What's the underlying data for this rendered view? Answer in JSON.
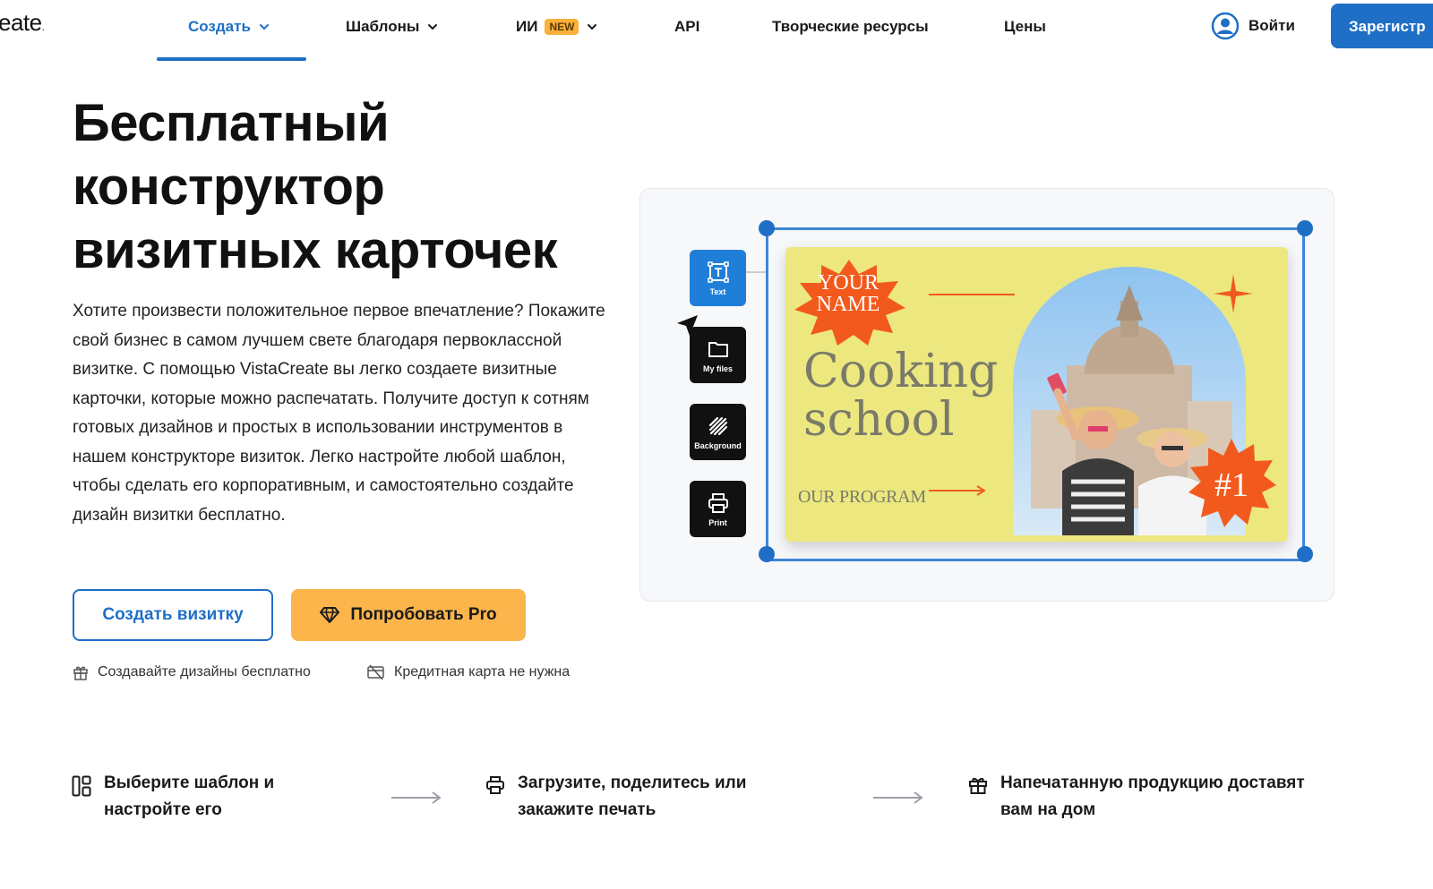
{
  "nav": {
    "logo": "eate",
    "logo_dot": ".",
    "items": [
      {
        "label": "Создать"
      },
      {
        "label": "Шаблоны"
      },
      {
        "label": "ИИ",
        "badge": "NEW"
      },
      {
        "label": "API"
      },
      {
        "label": "Творческие ресурсы"
      },
      {
        "label": "Цены"
      }
    ],
    "login": "Войти",
    "signup": "Зарегистр"
  },
  "hero": {
    "title_lines": [
      "Бесплатный",
      "конструктор",
      "визитных карточек"
    ],
    "description": "Хотите произвести положительное первое впечатление? Покажите свой бизнес в самом лучшем свете благодаря первоклассной визитке. С помощью VistaCreate вы легко создаете визитные карточки, которые можно распечатать. Получите доступ к сотням готовых дизайнов и простых в использовании инструментов в нашем конструкторе визиток. Легко настройте любой шаблон, чтобы сделать его корпоративным, и самостоятельно создайте дизайн визитки бесплатно.",
    "btn_create": "Создать визитку",
    "btn_pro": "Попробовать Pro",
    "perk_free": "Создавайте дизайны бесплатно",
    "perk_card": "Кредитная карта не нужна"
  },
  "editor": {
    "tools": [
      {
        "label": "Text",
        "icon": "text-box-icon",
        "selected": true
      },
      {
        "label": "My files",
        "icon": "folder-icon",
        "selected": false
      },
      {
        "label": "Background",
        "icon": "background-pattern-icon",
        "selected": false
      },
      {
        "label": "Print",
        "icon": "printer-icon",
        "selected": false
      }
    ],
    "card": {
      "name_line1": "YOUR",
      "name_line2": "NAME",
      "title_line1": "Cooking",
      "title_line2": "school",
      "program": "OUR PROGRAM",
      "badge": "#1",
      "background": "#ece87f",
      "accent": "#f25a1d"
    }
  },
  "steps": [
    {
      "line1": "Выберите шаблон и",
      "line2": "настройте его",
      "icon": "layout-icon"
    },
    {
      "line1": "Загрузите, поделитесь или",
      "line2": "закажите печать",
      "icon": "printer-icon"
    },
    {
      "line1": "Напечатанную продукцию доставят",
      "line2": "вам на дом",
      "icon": "gift-icon"
    }
  ],
  "colors": {
    "brand_blue": "#1f6fc6",
    "pro_orange": "#fbb54b",
    "new_badge": "#f9b13b"
  }
}
